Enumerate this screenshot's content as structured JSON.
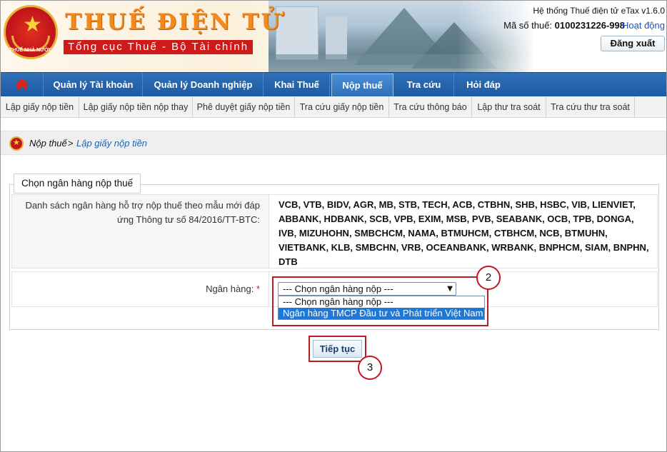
{
  "header": {
    "brand_title": "THUẾ ĐIỆN TỬ",
    "brand_subtitle": "Tổng cục Thuế - Bộ Tài chính",
    "emblem_text": "THUẾ NHÀ NƯỚC",
    "system_name": "Hệ thống Thuế điện tử eTax v1.6.0",
    "tax_id_label": "Mã số thuế:",
    "tax_id_value": "0100231226-998",
    "activity_link": "Hoạt động",
    "logout_label": "Đăng xuất"
  },
  "main_nav": {
    "home_icon": "home-icon",
    "items": [
      {
        "label": "Quản lý Tài khoản"
      },
      {
        "label": "Quản lý Doanh nghiệp"
      },
      {
        "label": "Khai Thuế"
      },
      {
        "label": "Nộp thuế",
        "active": true
      },
      {
        "label": "Tra cứu"
      },
      {
        "label": "Hỏi đáp"
      }
    ]
  },
  "sub_nav": {
    "items": [
      {
        "label": "Lập giấy nộp tiền"
      },
      {
        "label": "Lập giấy nộp tiền nộp thay"
      },
      {
        "label": "Phê duyệt giấy nộp tiền"
      },
      {
        "label": "Tra cứu giấy nộp tiền"
      },
      {
        "label": "Tra cứu thông báo"
      },
      {
        "label": "Lập thư tra soát"
      },
      {
        "label": "Tra cứu thư tra soát"
      }
    ]
  },
  "breadcrumb": {
    "parent": "Nộp thuế",
    "separator": ">",
    "current": "Lập giấy nộp tiền"
  },
  "form": {
    "legend": "Chọn ngân hàng nộp thuế",
    "bank_list_label": "Danh sách ngân hàng hỗ trợ nộp thuế theo mẫu mới đáp ứng Thông tư số 84/2016/TT-BTC:",
    "bank_list_value": "VCB, VTB, BIDV, AGR, MB, STB, TECH, ACB, CTBHN, SHB, HSBC, VIB, LIENVIET, ABBANK, HDBANK, SCB, VPB, EXIM, MSB, PVB, SEABANK, OCB, TPB, DONGA, IVB, MIZUHOHN, SMBCHCM, NAMA, BTMUHCM, CTBHCM, NCB, BTMUHN, VIETBANK, KLB, SMBCHN, VRB, OCEANBANK, WRBANK, BNPHCM, SIAM, BNPHN, DTB",
    "bank_label": "Ngân hàng:",
    "required_mark": "*",
    "select_value": "--- Chọn ngân hàng nộp ---",
    "options": [
      {
        "label": "--- Chọn ngân hàng nộp ---"
      },
      {
        "label": "Ngân hàng TMCP Đầu tư và Phát triển Việt Nam",
        "selected": true
      }
    ],
    "continue_label": "Tiếp tục"
  },
  "callouts": {
    "step2": "2",
    "step3": "3"
  },
  "colors": {
    "nav_blue": "#1d5aa3",
    "brand_orange": "#f08a1c",
    "brand_red": "#cf1a1a",
    "highlight_red": "#b51f24",
    "selected_option": "#1e78d8"
  }
}
